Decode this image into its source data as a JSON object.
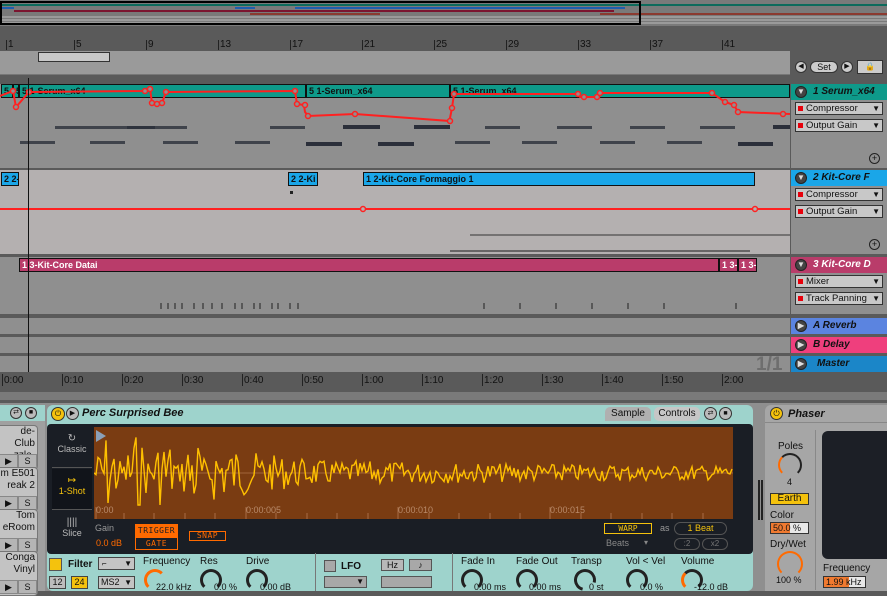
{
  "arrangement": {
    "beat_ruler": [
      "1",
      "5",
      "9",
      "13",
      "17",
      "21",
      "25",
      "29",
      "33",
      "37",
      "41"
    ],
    "time_ruler": [
      "0:00",
      "0:10",
      "0:20",
      "0:30",
      "0:40",
      "0:50",
      "1:00",
      "1:10",
      "1:20",
      "1:30",
      "1:40",
      "1:50",
      "2:00"
    ],
    "locator_controls": {
      "prev": "◀",
      "set": "Set",
      "next": "▶",
      "lock": "🔒"
    },
    "page_indicator": "1/1"
  },
  "tracks": [
    {
      "name": "1 Serum_x64",
      "color": "#0e9a8a",
      "clips": [
        "5 1-",
        "5 1-Serum_x64",
        "5 1-Serum_x64",
        "5 1-Serum_x64"
      ],
      "device_chooser": "Compressor",
      "parameter_chooser": "Output Gain"
    },
    {
      "name": "2 Kit-Core F",
      "color": "#1aa6e8",
      "clips": [
        "2 2-",
        "2 2-Ki",
        "1 2-Kit-Core Formaggio 1"
      ],
      "device_chooser": "Compressor",
      "parameter_chooser": "Output Gain"
    },
    {
      "name": "3 Kit-Core D",
      "color": "#b93c6a",
      "clips": [
        "1 3-Kit-Core Datai",
        "1 3-",
        "1 3-"
      ],
      "device_chooser": "Mixer",
      "parameter_chooser": "Track Panning"
    }
  ],
  "returns": [
    {
      "name": "A Reverb",
      "color": "#5b84e0"
    },
    {
      "name": "B Delay",
      "color": "#ef3f7d"
    },
    {
      "name": "Master",
      "color": "#1b86c8"
    }
  ],
  "drum_pads": [
    {
      "line1": "de-Club",
      "line2": "zzle-Bru",
      "solo": "S"
    },
    {
      "line1": "m E501",
      "line2": "reak 2",
      "solo": "S"
    },
    {
      "line1": "Tom",
      "line2": "eRoom",
      "solo": "S"
    },
    {
      "line1": "Conga",
      "line2": "Vinyl",
      "solo": "S"
    }
  ],
  "simpler": {
    "title": "Perc Surprised Bee",
    "tabs": [
      "Sample",
      "Controls"
    ],
    "active_tab": "Sample",
    "modes": [
      {
        "label": "Classic",
        "icon": "loop-icon"
      },
      {
        "label": "1-Shot",
        "icon": "oneshot-icon"
      },
      {
        "label": "Slice",
        "icon": "slice-icon"
      }
    ],
    "active_mode": "1-Shot",
    "time_marks": [
      "0:00",
      "0:00:005",
      "0:00:010",
      "0:00:015"
    ],
    "gain_label": "Gain",
    "gain_value": "0.0 dB",
    "trigger": "TRIGGER",
    "gate": "GATE",
    "snap": "SNAP",
    "warp": "WARP",
    "as_label": "as",
    "beat_value": "1 Beat",
    "warp_mode": "Beats",
    "half": ":2",
    "double": "x2",
    "filter": {
      "label": "Filter",
      "slope_12": "12",
      "slope_24": "24",
      "type": "MS2",
      "frequency_label": "Frequency",
      "frequency_value": "22.0 kHz",
      "res_label": "Res",
      "res_value": "0.0 %",
      "drive_label": "Drive",
      "drive_value": "0.00 dB"
    },
    "lfo": {
      "label": "LFO",
      "hz": "Hz",
      "note": "♪"
    },
    "fade_in_label": "Fade In",
    "fade_in_value": "0.00 ms",
    "fade_out_label": "Fade Out",
    "fade_out_value": "0.00 ms",
    "transp_label": "Transp",
    "transp_value": "0 st",
    "vol_vel_label": "Vol < Vel",
    "vol_vel_value": "0.0 %",
    "volume_label": "Volume",
    "volume_value": "-12.0 dB",
    "accent": "#ff6a00",
    "wave_color": "#ffc000"
  },
  "phaser": {
    "title": "Phaser",
    "poles_label": "Poles",
    "poles_value": "4",
    "mode": "Earth",
    "color_label": "Color",
    "color_value": "50.0 %",
    "color_fraction": 0.5,
    "drywet_label": "Dry/Wet",
    "drywet_value": "100 %",
    "frequency_label": "Frequency",
    "frequency_value": "1.99 kHz"
  }
}
